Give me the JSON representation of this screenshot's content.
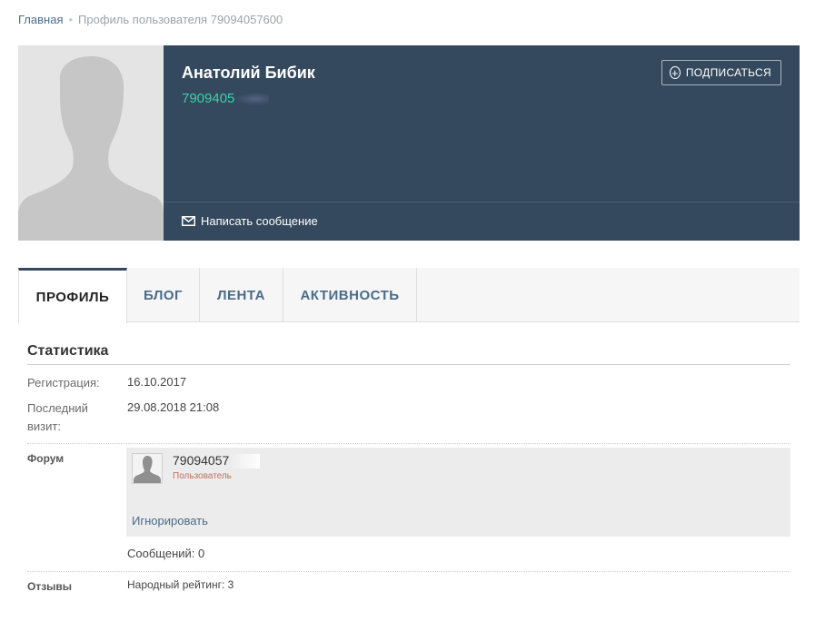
{
  "breadcrumb": {
    "home": "Главная",
    "separator": "•",
    "current": "Профиль пользователя 79094057600"
  },
  "profile": {
    "name": "Анатолий Бибик",
    "phone_visible": "7909405",
    "subscribe_label": "ПОДПИСАТЬСЯ",
    "write_message_label": "Написать сообщение"
  },
  "tabs": [
    {
      "label": "ПРОФИЛЬ",
      "active": true
    },
    {
      "label": "БЛОГ",
      "active": false
    },
    {
      "label": "ЛЕНТА",
      "active": false
    },
    {
      "label": "АКТИВНОСТЬ",
      "active": false
    }
  ],
  "stats": {
    "title": "Статистика",
    "registration_label": "Регистрация:",
    "registration_value": "16.10.2017",
    "last_visit_label": "Последний визит:",
    "last_visit_value": "29.08.2018 21:08"
  },
  "forum": {
    "label": "Форум",
    "user_name_visible": "79094057",
    "role": "Пользователь",
    "ignore_label": "Игнорировать",
    "messages": "Сообщений: 0"
  },
  "reviews": {
    "label": "Отзывы",
    "rating": "Народный рейтинг: 3"
  },
  "colors": {
    "header_bg": "#34495e",
    "phone": "#3ecfaa",
    "link": "#4a6b8a",
    "role": "#c0715a"
  }
}
